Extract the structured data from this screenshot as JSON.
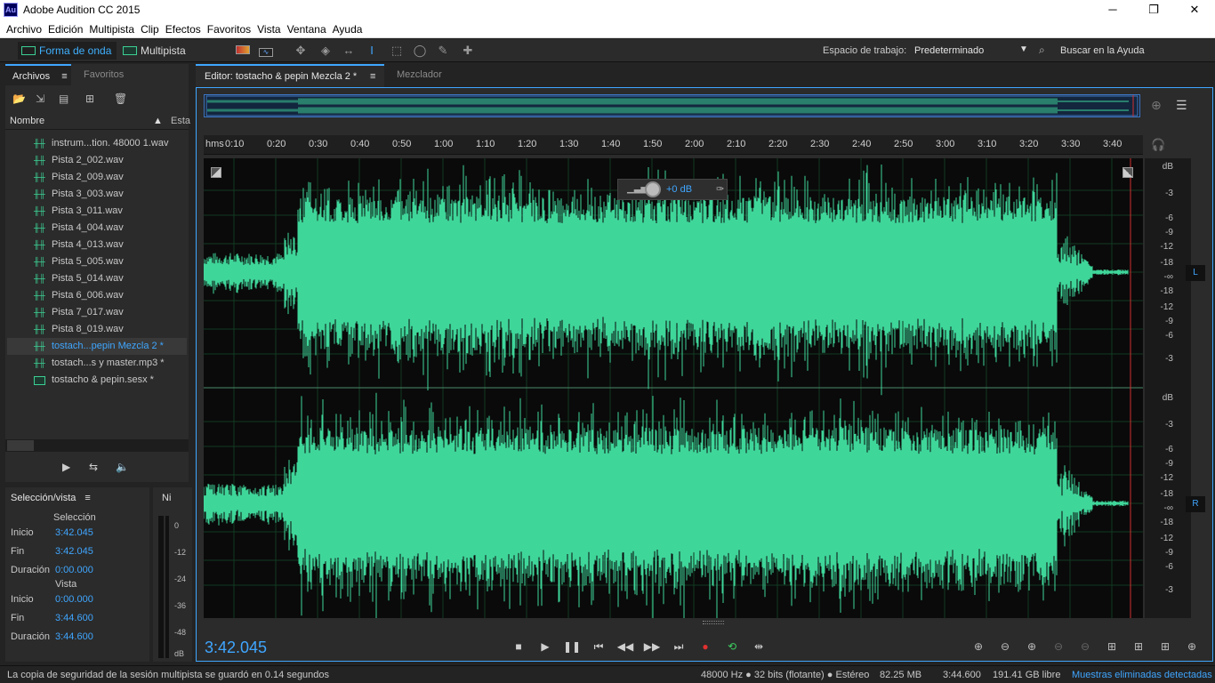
{
  "window": {
    "title": "Adobe Audition CC 2015",
    "logo_text": "Au",
    "minimize": "─",
    "maximize": "❐",
    "close": "✕"
  },
  "menu": [
    "Archivo",
    "Edición",
    "Multipista",
    "Clip",
    "Efectos",
    "Favoritos",
    "Vista",
    "Ventana",
    "Ayuda"
  ],
  "modes": {
    "waveform": "Forma de onda",
    "multitrack": "Multipista"
  },
  "workspace": {
    "label": "Espacio de trabajo:",
    "value": "Predeterminado"
  },
  "help": {
    "placeholder": "Buscar en la Ayuda"
  },
  "files_panel": {
    "tabs": [
      "Archivos",
      "Favoritos"
    ],
    "col_name": "Nombre",
    "col_state": "Esta",
    "items": [
      {
        "name": "instrum...tion. 48000 1.wav",
        "icon": "waveform-icon"
      },
      {
        "name": "Pista 2_002.wav",
        "icon": "waveform-icon"
      },
      {
        "name": "Pista 2_009.wav",
        "icon": "waveform-icon"
      },
      {
        "name": "Pista 3_003.wav",
        "icon": "waveform-icon"
      },
      {
        "name": "Pista 3_011.wav",
        "icon": "waveform-icon"
      },
      {
        "name": "Pista 4_004.wav",
        "icon": "waveform-icon"
      },
      {
        "name": "Pista 4_013.wav",
        "icon": "waveform-icon"
      },
      {
        "name": "Pista 5_005.wav",
        "icon": "waveform-icon"
      },
      {
        "name": "Pista 5_014.wav",
        "icon": "waveform-icon"
      },
      {
        "name": "Pista 6_006.wav",
        "icon": "waveform-icon"
      },
      {
        "name": "Pista 7_017.wav",
        "icon": "waveform-icon"
      },
      {
        "name": "Pista 8_019.wav",
        "icon": "waveform-icon"
      },
      {
        "name": "tostach...pepin Mezcla 2 *",
        "icon": "waveform-icon",
        "selected": true
      },
      {
        "name": "tostach...s y master.mp3 *",
        "icon": "waveform-icon"
      },
      {
        "name": "tostacho & pepin.sesx *",
        "icon": "session-icon"
      }
    ]
  },
  "selection_panel": {
    "title": "Selección/vista",
    "header": "Selección",
    "inicio_label": "Inicio",
    "inicio": "3:42.045",
    "fin_label": "Fin",
    "fin": "3:42.045",
    "duracion_label": "Duración",
    "duracion": "0:00.000",
    "vista_header": "Vista",
    "v_inicio_label": "Inicio",
    "v_inicio": "0:00.000",
    "v_fin_label": "Fin",
    "v_fin": "3:44.600",
    "v_duracion_label": "Duración",
    "v_duracion": "3:44.600"
  },
  "meter_panel": {
    "title": "Ni",
    "scale": [
      "0",
      "-12",
      "-24",
      "-36",
      "-48",
      "dB"
    ]
  },
  "editor": {
    "tab_label": "Editor: tostacho & pepin Mezcla 2 *",
    "mixer_label": "Mezclador",
    "ruler_unit": "hms",
    "ruler_ticks": [
      "0:10",
      "0:20",
      "0:30",
      "0:40",
      "0:50",
      "1:00",
      "1:10",
      "1:20",
      "1:30",
      "1:40",
      "1:50",
      "2:00",
      "2:10",
      "2:20",
      "2:30",
      "2:40",
      "2:50",
      "3:00",
      "3:10",
      "3:20",
      "3:30",
      "3:40"
    ],
    "hud_gain": "+0 dB",
    "db_scale_top": [
      "dB",
      "-3",
      "-6",
      "-9",
      "-12",
      "-18",
      "-∞",
      "-18",
      "-12",
      "-9",
      "-6",
      "-3"
    ],
    "db_scale_bottom": [
      "dB",
      "-3",
      "-6",
      "-9",
      "-12",
      "-18",
      "-∞",
      "-18",
      "-12",
      "-9",
      "-6",
      "-3"
    ],
    "channel_l": "L",
    "channel_r": "R",
    "playhead_time": "3:42.045",
    "wave_color": "#3fd69a",
    "playhead_color": "#d03030"
  },
  "status": {
    "message": "La copia de seguridad de la sesión multipista se guardó en 0.14 segundos",
    "format": "48000 Hz ● 32 bits (flotante) ● Estéreo",
    "size": "82.25 MB",
    "duration": "3:44.600",
    "free": "191.41 GB libre",
    "dropped": "Muestras eliminadas detectadas"
  }
}
